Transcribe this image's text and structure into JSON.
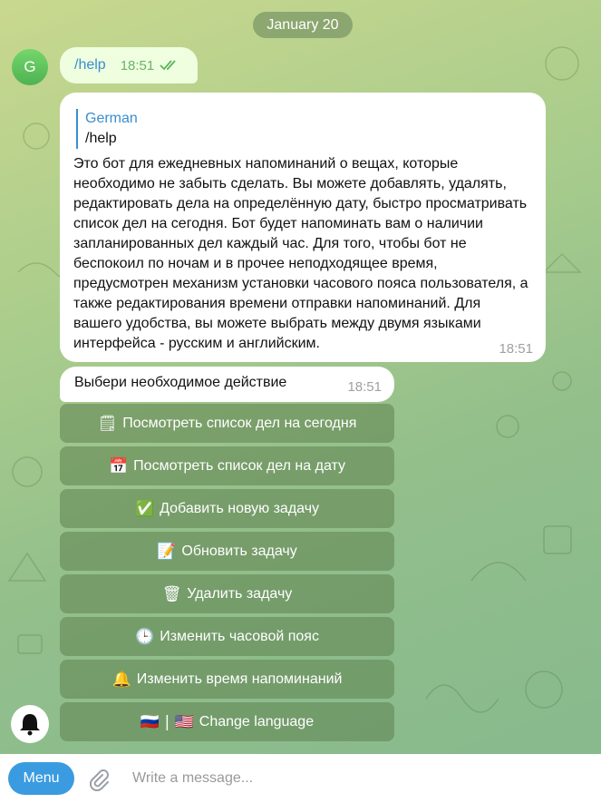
{
  "date_label": "January 20",
  "user": {
    "avatar_letter": "G"
  },
  "outgoing": {
    "text": "/help",
    "time": "18:51",
    "status_icon": "double-check-icon"
  },
  "bot_reply": {
    "reply_to_name": "German",
    "reply_to_text": "/help",
    "text": "Это бот для ежедневных напоминаний о вещах, которые необходимо не забыть сделать. Вы можете добавлять, удалять, редактировать дела на определённую дату, быстро просматривать список дел на сегодня. Бот будет напоминать вам о наличии запланированных дел каждый час. Для того, чтобы бот не беспокоил по ночам и в прочее неподходящее время, предусмотрен механизм установки часового пояса пользователя, а также редактирования времени отправки напоминаний. Для вашего удобства, вы можете выбрать между двумя языками интерфейса - русским и английским.",
    "time": "18:51"
  },
  "bot_prompt": {
    "text": "Выбери необходимое действие",
    "time": "18:51"
  },
  "keyboard": [
    {
      "icon": "🗒",
      "label": "Посмотреть список дел на сегодня"
    },
    {
      "icon": "📅",
      "label": "Посмотреть список дел на дату"
    },
    {
      "icon": "✅",
      "label": "Добавить новую задачу"
    },
    {
      "icon": "📝",
      "label": "Обновить задачу"
    },
    {
      "icon": "🗑",
      "label": "Удалить задачу"
    },
    {
      "icon": "🕒",
      "label": "Изменить часовой пояс"
    },
    {
      "icon": "🔔",
      "label": "Изменить время напоминаний"
    },
    {
      "icon": "🇷🇺 | 🇺🇸",
      "label": "Change language"
    }
  ],
  "input": {
    "menu_label": "Menu",
    "placeholder": "Write a message..."
  },
  "colors": {
    "accent": "#3a9be0",
    "link": "#3a8ed0",
    "outgoing_bg": "#eefedf",
    "keyboard_bg": "#5f8250"
  }
}
